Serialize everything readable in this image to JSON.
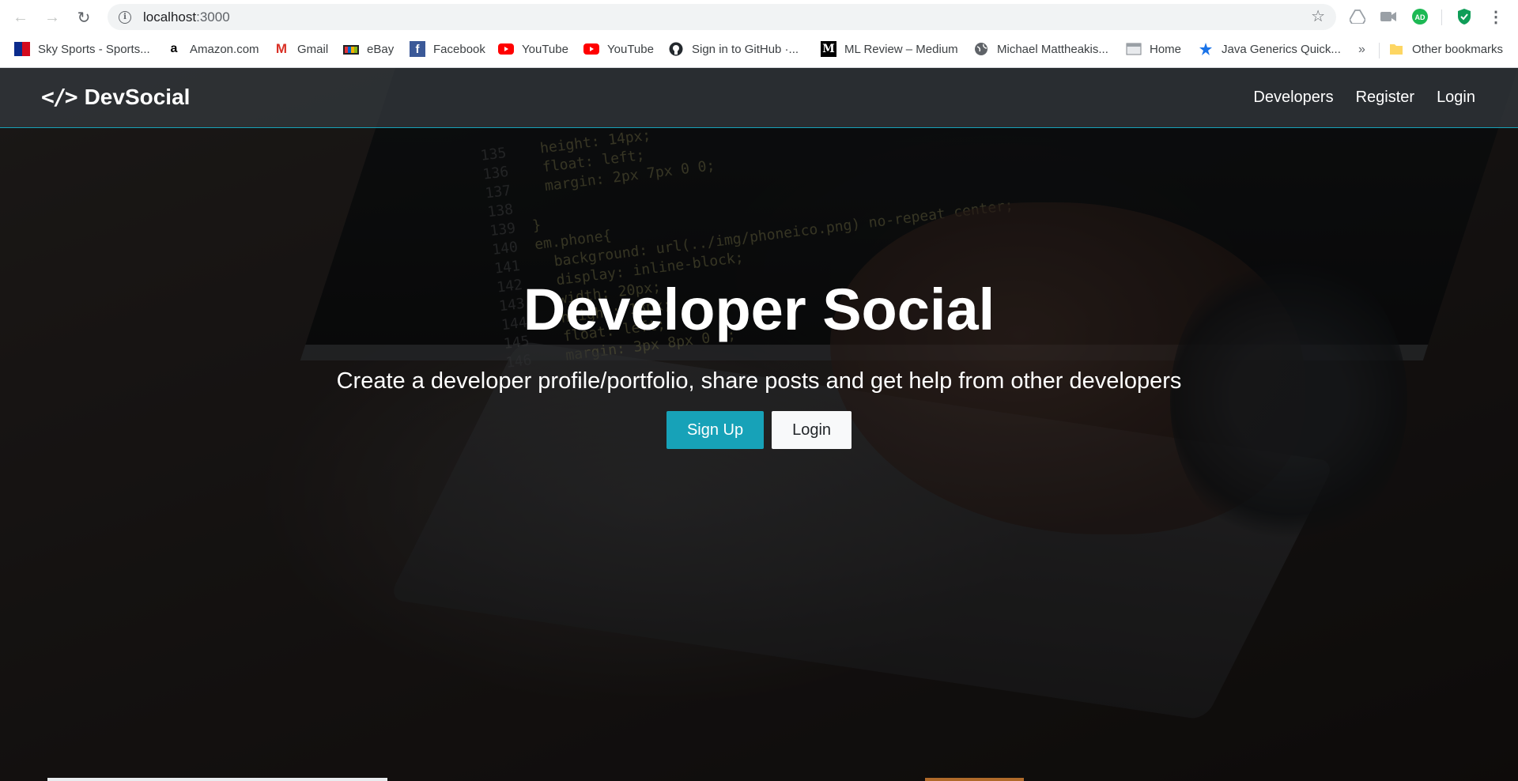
{
  "browser": {
    "url_host": "localhost",
    "url_port": ":3000",
    "bookmarks": [
      {
        "label": "Sky Sports - Sports...",
        "icon": "sky-sports-icon"
      },
      {
        "label": "Amazon.com",
        "icon": "amazon-icon"
      },
      {
        "label": "Gmail",
        "icon": "gmail-icon"
      },
      {
        "label": "eBay",
        "icon": "ebay-icon"
      },
      {
        "label": "Facebook",
        "icon": "facebook-icon"
      },
      {
        "label": "YouTube",
        "icon": "youtube-icon"
      },
      {
        "label": "YouTube",
        "icon": "youtube-icon"
      },
      {
        "label": "Sign in to GitHub ·...",
        "icon": "github-icon"
      },
      {
        "label": "ML Review – Medium",
        "icon": "medium-icon"
      },
      {
        "label": "Michael Mattheakis...",
        "icon": "globe-icon"
      },
      {
        "label": "Home",
        "icon": "page-icon"
      },
      {
        "label": "Java Generics Quick...",
        "icon": "java-icon"
      }
    ],
    "bookmarks_overflow": "»",
    "other_bookmarks": "Other bookmarks",
    "extension_badge": "AD"
  },
  "navbar": {
    "brand_icon": "</>",
    "brand": "DevSocial",
    "links": [
      "Developers",
      "Register",
      "Login"
    ]
  },
  "hero": {
    "title": "Developer Social",
    "lead": "Create a developer profile/portfolio, share posts and get help from other developers",
    "signup_label": "Sign Up",
    "login_label": "Login"
  },
  "background_code": [
    {
      "ln": "135",
      "text": "  height: 14px;"
    },
    {
      "ln": "136",
      "text": "  float: left;"
    },
    {
      "ln": "137",
      "text": "  margin: 2px 7px 0 0;"
    },
    {
      "ln": "138",
      "text": ""
    },
    {
      "ln": "139",
      "text": "}"
    },
    {
      "ln": "140",
      "text": "em.phone{"
    },
    {
      "ln": "141",
      "text": "  background: url(../img/phoneico.png) no-repeat center;"
    },
    {
      "ln": "142",
      "text": "  display: inline-block;"
    },
    {
      "ln": "143",
      "text": "  width: 20px;"
    },
    {
      "ln": "144",
      "text": "  height: 18px;"
    },
    {
      "ln": "145",
      "text": "  float: left;"
    },
    {
      "ln": "146",
      "text": "  margin: 3px 8px 0 0;"
    }
  ],
  "colors": {
    "accent": "#17a2b8",
    "navbar": "#343a40"
  }
}
